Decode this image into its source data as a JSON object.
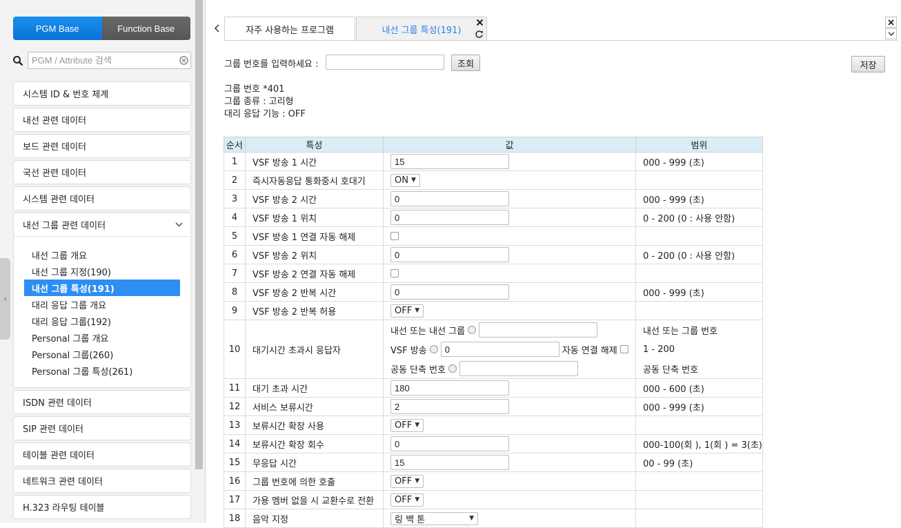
{
  "sidebar": {
    "pgm_base": "PGM Base",
    "function_base": "Function Base",
    "search_placeholder": "PGM / Attribute 검색",
    "items_top": [
      "시스템 ID & 번호 체계",
      "내선 관련 데이터",
      "보드 관련 데이터",
      "국선 관련 데이터",
      "시스템 관련 데이터"
    ],
    "group_title": "내선 그룹 관련 데이터",
    "group_items": [
      "내선 그룹 개요",
      "내선 그룹 지정(190)",
      "내선 그룹 특성(191)",
      "대리 응답 그룹 개요",
      "대리 응답 그룹(192)",
      "Personal 그룹 개요",
      "Personal 그룹(260)",
      "Personal 그룹 특성(261)"
    ],
    "active_index": 2,
    "items_bottom": [
      "ISDN 관련 데이터",
      "SIP 관련 데이터",
      "테이블 관련 데이터",
      "네트워크 관련 데이터",
      "H.323 라우팅 테이블"
    ]
  },
  "tabs": {
    "frequent": "자주 사용하는 프로그램",
    "current": "내선 그룹 특성(191)"
  },
  "form": {
    "group_input_label": "그룹 번호를 입력하세요 :",
    "group_input_value": "",
    "query_button": "조회",
    "save_button": "저장",
    "info_group_no": "그룹 번호 *401",
    "info_group_type": "그룹 종류 : 고리형",
    "info_proxy": "대리 응답 기능 : OFF"
  },
  "table": {
    "headers": [
      "순서",
      "특성",
      "값",
      "범위"
    ],
    "rows": [
      {
        "no": "1",
        "name": "VSF 방송 1 시간",
        "kind": "text",
        "value": "15",
        "range": "000 - 999 (초)"
      },
      {
        "no": "2",
        "name": "즉시자동응답 통화중시 호대기",
        "kind": "select",
        "value": "ON",
        "range": ""
      },
      {
        "no": "3",
        "name": "VSF 방송 2 시간",
        "kind": "text",
        "value": "0",
        "range": "000 - 999 (초)"
      },
      {
        "no": "4",
        "name": "VSF 방송 1 위치",
        "kind": "text",
        "value": "0",
        "range": "0 - 200 (0 : 사용 안함)"
      },
      {
        "no": "5",
        "name": "VSF 방송 1 연결 자동 해제",
        "kind": "check",
        "value": "",
        "range": ""
      },
      {
        "no": "6",
        "name": "VSF 방송 2 위치",
        "kind": "text",
        "value": "0",
        "range": "0 - 200 (0 : 사용 안함)"
      },
      {
        "no": "7",
        "name": "VSF 방송 2 연결 자동 해제",
        "kind": "check",
        "value": "",
        "range": ""
      },
      {
        "no": "8",
        "name": "VSF 방송 2 반복 시간",
        "kind": "text",
        "value": "0",
        "range": "000 - 999 (초)"
      },
      {
        "no": "9",
        "name": "VSF 방송 2 반복 허용",
        "kind": "select",
        "value": "OFF",
        "range": ""
      },
      {
        "no": "11",
        "name": "대기 초과 시간",
        "kind": "text",
        "value": "180",
        "range": "000 - 600 (초)"
      },
      {
        "no": "12",
        "name": "서비스 보류시간",
        "kind": "text",
        "value": "2",
        "range": "000 - 999 (초)"
      },
      {
        "no": "13",
        "name": "보류시간 확장 사용",
        "kind": "select",
        "value": "OFF",
        "range": ""
      },
      {
        "no": "14",
        "name": "보류시간 확장 회수",
        "kind": "text",
        "value": "0",
        "range": "000-100(회 ), 1(회 ) = 3(초)"
      },
      {
        "no": "15",
        "name": "무응답 시간",
        "kind": "text",
        "value": "15",
        "range": "00 - 99 (초)"
      },
      {
        "no": "16",
        "name": "그룹 번호에 의한 호출",
        "kind": "select",
        "value": "OFF",
        "range": ""
      },
      {
        "no": "17",
        "name": "가용 멤버 없을 시 교환수로 전환",
        "kind": "select",
        "value": "OFF",
        "range": ""
      },
      {
        "no": "18",
        "name": "음악 지정",
        "kind": "wideselect",
        "value": "링 백 톤",
        "range": ""
      }
    ],
    "row10": {
      "no": "10",
      "name": "대기시간 초과시 응답자",
      "opt1_label": "내선 또는 내선 그룹",
      "opt1_value": "",
      "opt1_range": "내선 또는 그룹 번호",
      "opt2_label": "VSF 방송",
      "opt2_value": "0",
      "opt2_extra": "자동 연결 해제",
      "opt2_range": "1 - 200",
      "opt3_label": "공동 단축 번호",
      "opt3_value": "",
      "opt3_range": "공동 단축 번호"
    }
  }
}
